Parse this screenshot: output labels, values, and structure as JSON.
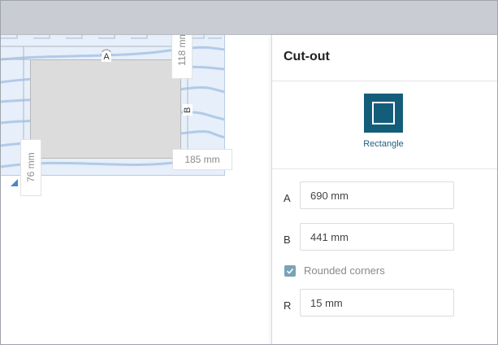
{
  "canvas": {
    "cutout_letter_a": "A",
    "cutout_letter_b": "B",
    "dim_top": "118 mm",
    "dim_right": "185 mm",
    "dim_left": "76 mm",
    "accent_color": "#145d7a"
  },
  "panel": {
    "title": "Cut-out",
    "shape": {
      "label": "Rectangle",
      "icon": "rectangle-icon",
      "selected": true
    },
    "fields": [
      {
        "label": "A",
        "value": "690 mm"
      },
      {
        "label": "B",
        "value": "441 mm"
      },
      {
        "label": "R",
        "value": "15 mm"
      }
    ],
    "rounded_corners": {
      "label": "Rounded corners",
      "checked": true
    }
  }
}
